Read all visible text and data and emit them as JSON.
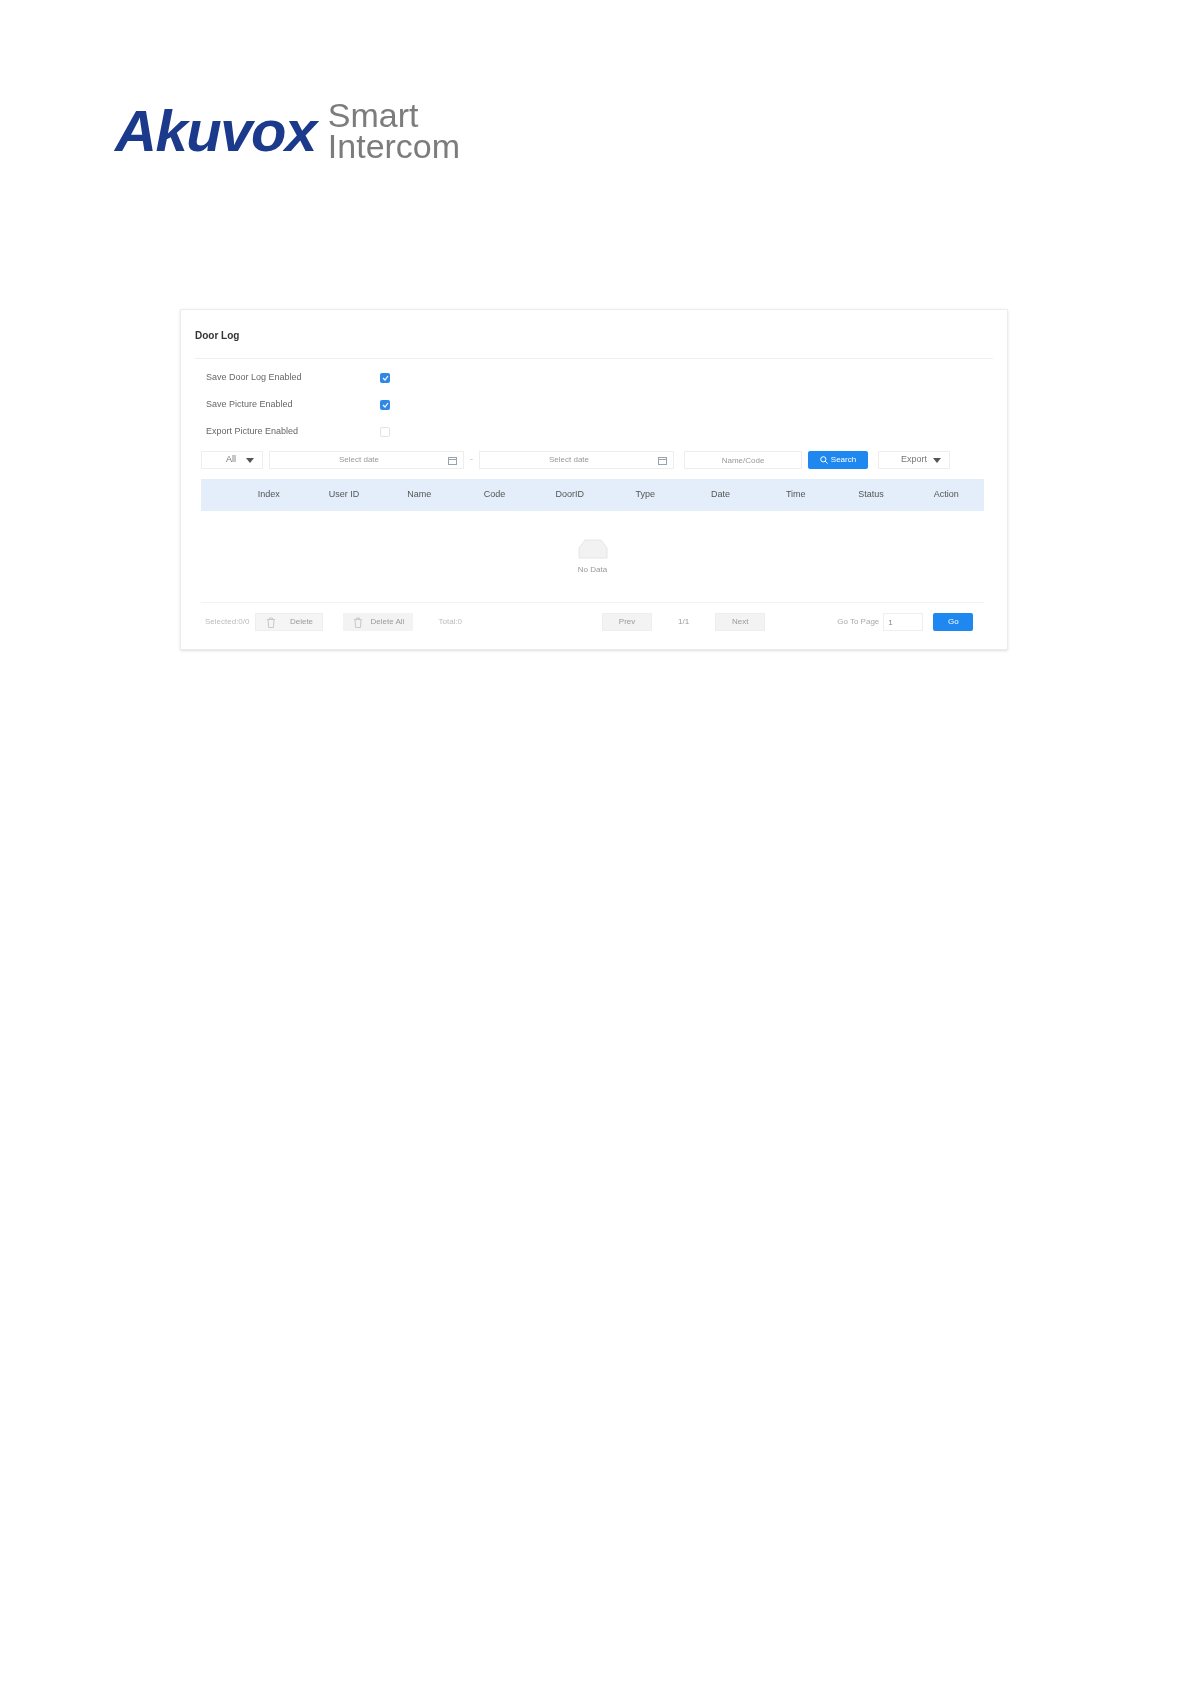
{
  "logo": {
    "brand": "Akuvox",
    "tagline": [
      "Smart",
      "Intercom"
    ]
  },
  "panel": {
    "title": "Door Log",
    "settings": [
      {
        "label": "Save Door Log Enabled",
        "checked": true
      },
      {
        "label": "Save Picture Enabled",
        "checked": true
      },
      {
        "label": "Export Picture Enabled",
        "checked": false
      }
    ],
    "filter": {
      "type": "All",
      "start_date": {
        "placeholder": "Select date"
      },
      "separator": "-",
      "end_date": {
        "placeholder": "Select date"
      },
      "keyword": {
        "placeholder": "Name/Code"
      },
      "search": "Search",
      "export": "Export"
    },
    "table": {
      "columns": [
        "Index",
        "User ID",
        "Name",
        "Code",
        "DoorID",
        "Type",
        "Date",
        "Time",
        "Status",
        "Action"
      ],
      "empty": "No Data"
    },
    "footer": {
      "selected": "Selected:0/0",
      "delete": "Delete",
      "delete_all": "Delete All",
      "total": "Total:0",
      "prev": "Prev",
      "page": "1/1",
      "next": "Next",
      "goto_label": "Go To Page",
      "goto_value": "1",
      "go": "Go"
    }
  }
}
